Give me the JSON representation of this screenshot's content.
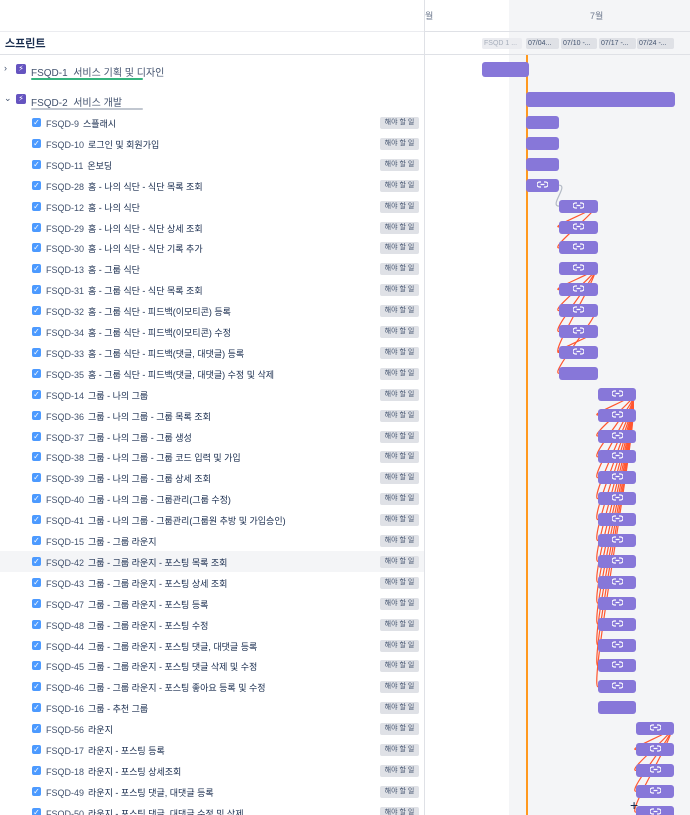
{
  "header": {
    "month_june": "월",
    "month_july": "7월",
    "sprint_column_title": "스프린트"
  },
  "sprints": [
    "FSQD 1 ...",
    "07/04...",
    "07/10 -...",
    "07/17 -...",
    "07/24 -..."
  ],
  "epics": [
    {
      "key": "FSQD-1",
      "title": "서비스 기획 및 디자인",
      "expanded": false,
      "progress_color": "#36b37e"
    },
    {
      "key": "FSQD-2",
      "title": "서비스 개발",
      "expanded": true,
      "progress_color": "#c1c7d0"
    }
  ],
  "issues": [
    {
      "key": "FSQD-9",
      "title": "스플래시",
      "status": "해야 할 일"
    },
    {
      "key": "FSQD-10",
      "title": "로그인 및 회원가입",
      "status": "해야 할 일"
    },
    {
      "key": "FSQD-11",
      "title": "온보딩",
      "status": "해야 할 일"
    },
    {
      "key": "FSQD-28",
      "title": "홈 - 나의 식단 - 식단 목록 조회",
      "status": "해야 할 일"
    },
    {
      "key": "FSQD-12",
      "title": "홈 - 나의 식단",
      "status": "해야 할 일"
    },
    {
      "key": "FSQD-29",
      "title": "홈 - 나의 식단 - 식단 상세 조회",
      "status": "해야 할 일"
    },
    {
      "key": "FSQD-30",
      "title": "홈 - 나의 식단 - 식단 기록 추가",
      "status": "해야 할 일"
    },
    {
      "key": "FSQD-13",
      "title": "홈 - 그룹 식단",
      "status": "해야 할 일"
    },
    {
      "key": "FSQD-31",
      "title": "홈 - 그룹 식단 - 식단 목록 조회",
      "status": "해야 할 일"
    },
    {
      "key": "FSQD-32",
      "title": "홈 - 그룹 식단 - 피드백(이모티콘) 등록",
      "status": "해야 할 일"
    },
    {
      "key": "FSQD-34",
      "title": "홈 - 그룹 식단 - 피드백(이모티콘) 수정",
      "status": "해야 할 일"
    },
    {
      "key": "FSQD-33",
      "title": "홈 - 그룹 식단 - 피드백(댓글, 대댓글) 등록",
      "status": "해야 할 일"
    },
    {
      "key": "FSQD-35",
      "title": "홈 - 그룹 식단 - 피드백(댓글, 대댓글) 수정 및 삭제",
      "status": "해야 할 일"
    },
    {
      "key": "FSQD-14",
      "title": "그룹 - 나의 그룹",
      "status": "해야 할 일"
    },
    {
      "key": "FSQD-36",
      "title": "그룹 - 나의 그룹 - 그룹 목록 조회",
      "status": "해야 할 일"
    },
    {
      "key": "FSQD-37",
      "title": "그룹 - 나의 그룹 - 그룹 생성",
      "status": "해야 할 일"
    },
    {
      "key": "FSQD-38",
      "title": "그룹 - 나의 그룹 - 그룹 코드 입력 및 가입",
      "status": "해야 할 일"
    },
    {
      "key": "FSQD-39",
      "title": "그룹 - 나의 그룹 - 그룹 상세 조회",
      "status": "해야 할 일"
    },
    {
      "key": "FSQD-40",
      "title": "그룹 - 나의 그룹 - 그룹관리(그룹 수정)",
      "status": "해야 할 일"
    },
    {
      "key": "FSQD-41",
      "title": "그룹 - 나의 그룹 - 그룹관리(그룹원 추방 및 가입승인)",
      "status": "해야 할 일"
    },
    {
      "key": "FSQD-15",
      "title": "그룹 - 그룹 라운지",
      "status": "해야 할 일"
    },
    {
      "key": "FSQD-42",
      "title": "그룹 - 그룹 라운지 - 포스팅 목록 조회",
      "status": "해야 할 일"
    },
    {
      "key": "FSQD-43",
      "title": "그룹 - 그룹 라운지 - 포스팅 상세 조회",
      "status": "해야 할 일"
    },
    {
      "key": "FSQD-47",
      "title": "그룹 - 그룹 라운지 - 포스팅 등록",
      "status": "해야 할 일"
    },
    {
      "key": "FSQD-48",
      "title": "그룹 - 그룹 라운지 - 포스팅 수정",
      "status": "해야 할 일"
    },
    {
      "key": "FSQD-44",
      "title": "그룹 - 그룹 라운지 - 포스팅 댓글, 대댓글 등록",
      "status": "해야 할 일"
    },
    {
      "key": "FSQD-45",
      "title": "그룹 - 그룹 라운지 - 포스팅 댓글 삭제 및 수정",
      "status": "해야 할 일"
    },
    {
      "key": "FSQD-46",
      "title": "그룹 - 그룹 라운지 - 포스팅 좋아요 등록 및 수정",
      "status": "해야 할 일"
    },
    {
      "key": "FSQD-16",
      "title": "그룹 - 추천 그룹",
      "status": "해야 할 일"
    },
    {
      "key": "FSQD-56",
      "title": "라운지",
      "status": "해야 할 일"
    },
    {
      "key": "FSQD-17",
      "title": "라운지 - 포스팅 등록",
      "status": "해야 할 일"
    },
    {
      "key": "FSQD-18",
      "title": "라운지 - 포스팅 상세조회",
      "status": "해야 할 일"
    },
    {
      "key": "FSQD-49",
      "title": "라운지 - 포스팅 댓글, 대댓글 등록",
      "status": "해야 할 일"
    },
    {
      "key": "FSQD-50",
      "title": "라운지 - 포스팅 댓글, 대댓글 수정 및 삭제",
      "status": "해야 할 일"
    }
  ],
  "colors": {
    "bar": "#8777d9",
    "today": "#ff991f",
    "dependency": "#ff5630",
    "checkbox": "#4c9aff"
  },
  "icons": {
    "link": "link-icon",
    "checkbox": "checkbox-icon",
    "epic": "epic-icon",
    "cursor": "plus-cursor-icon"
  }
}
